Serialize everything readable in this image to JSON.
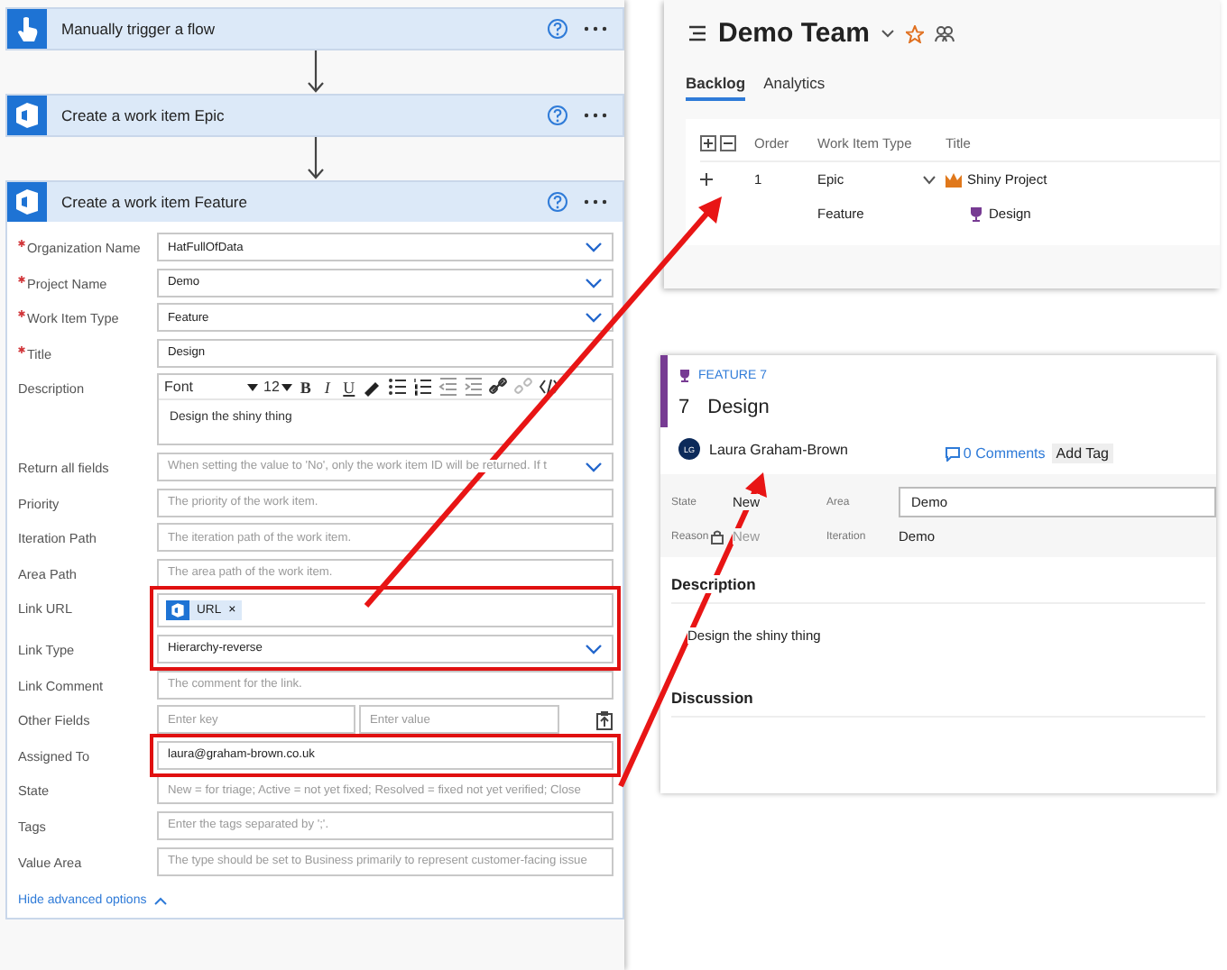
{
  "flow": {
    "steps": [
      {
        "kind": "trigger",
        "title": "Manually trigger a flow"
      },
      {
        "kind": "devops",
        "title": "Create a work item Epic"
      },
      {
        "kind": "devops",
        "title": "Create a work item Feature",
        "form": {
          "fields": [
            {
              "kind": "dropdown",
              "label": "Organization Name",
              "required": true,
              "highlighted": false,
              "value": "HatFullOfData"
            },
            {
              "kind": "dropdown",
              "label": "Project Name",
              "required": true,
              "highlighted": false,
              "value": "Demo"
            },
            {
              "kind": "dropdown",
              "label": "Work Item Type",
              "required": true,
              "highlighted": false,
              "value": "Feature"
            },
            {
              "kind": "text",
              "label": "Title",
              "required": true,
              "highlighted": false,
              "value": "Design"
            },
            {
              "kind": "richtext",
              "label": "Description",
              "required": false,
              "highlighted": false,
              "font": "Font",
              "size": "12",
              "bold": "B",
              "italic": "I",
              "underline": "U",
              "value": "Design the shiny thing"
            },
            {
              "kind": "dropdown",
              "label": "Return all fields",
              "required": false,
              "highlighted": false,
              "placeholder": "When setting the value to 'No', only the work item ID will be returned. If t"
            },
            {
              "kind": "text",
              "label": "Priority",
              "required": false,
              "highlighted": false,
              "placeholder": "The priority of the work item."
            },
            {
              "kind": "text",
              "label": "Iteration Path",
              "required": false,
              "highlighted": false,
              "placeholder": "The iteration path of the work item."
            },
            {
              "kind": "text",
              "label": "Area Path",
              "required": false,
              "highlighted": false,
              "placeholder": "The area path of the work item."
            },
            {
              "kind": "token",
              "label": "Link URL",
              "required": false,
              "highlighted": true,
              "token": "URL",
              "remove": "×"
            },
            {
              "kind": "dropdown",
              "label": "Link Type",
              "required": false,
              "highlighted": true,
              "value": "Hierarchy-reverse"
            },
            {
              "kind": "text",
              "label": "Link Comment",
              "required": false,
              "highlighted": false,
              "placeholder": "The comment for the link."
            },
            {
              "kind": "pair",
              "label": "Other Fields",
              "required": false,
              "highlighted": false,
              "placeholder": "Enter key",
              "placeholder_2": "Enter value"
            },
            {
              "kind": "text",
              "label": "Assigned To",
              "required": false,
              "highlighted": true,
              "value": "laura@graham-brown.co.uk"
            },
            {
              "kind": "text",
              "label": "State",
              "required": false,
              "highlighted": false,
              "placeholder": "New = for triage; Active = not yet fixed; Resolved = fixed not yet verified; Close"
            },
            {
              "kind": "text",
              "label": "Tags",
              "required": false,
              "highlighted": false,
              "placeholder": "Enter the tags separated by ';'."
            },
            {
              "kind": "text",
              "label": "Value Area",
              "required": false,
              "highlighted": false,
              "placeholder": "The type should be set to Business primarily to represent customer-facing issue"
            }
          ],
          "toggle": "Hide advanced options"
        }
      }
    ]
  },
  "backlog": {
    "team": "Demo Team",
    "tabs": [
      {
        "label": "Backlog",
        "selected": true
      },
      {
        "label": "Analytics",
        "selected": false
      }
    ],
    "columns": [
      "Order",
      "Work Item Type",
      "Title"
    ],
    "rows": [
      {
        "kind": "epic",
        "order": "1",
        "type": "Epic",
        "title": "Shiny Project",
        "expanded": true
      },
      {
        "kind": "feature",
        "type": "Feature",
        "title": "Design"
      }
    ]
  },
  "work_item": {
    "type_label": "FEATURE 7",
    "id": "7",
    "title": "Design",
    "assignee": "Laura Graham-Brown",
    "initials": "LG",
    "comments": "0 Comments",
    "add_tag": "Add Tag",
    "fields": [
      {
        "label": "State",
        "value": "New",
        "kind": "plain"
      },
      {
        "label": "Area",
        "value": "Demo",
        "kind": "input"
      },
      {
        "label": "Reason",
        "value": "New",
        "kind": "locked"
      },
      {
        "label": "Iteration",
        "value": "Demo",
        "kind": "plain"
      }
    ],
    "sections": [
      {
        "heading": "Description",
        "body": "Design the shiny thing"
      },
      {
        "heading": "Discussion"
      }
    ]
  }
}
